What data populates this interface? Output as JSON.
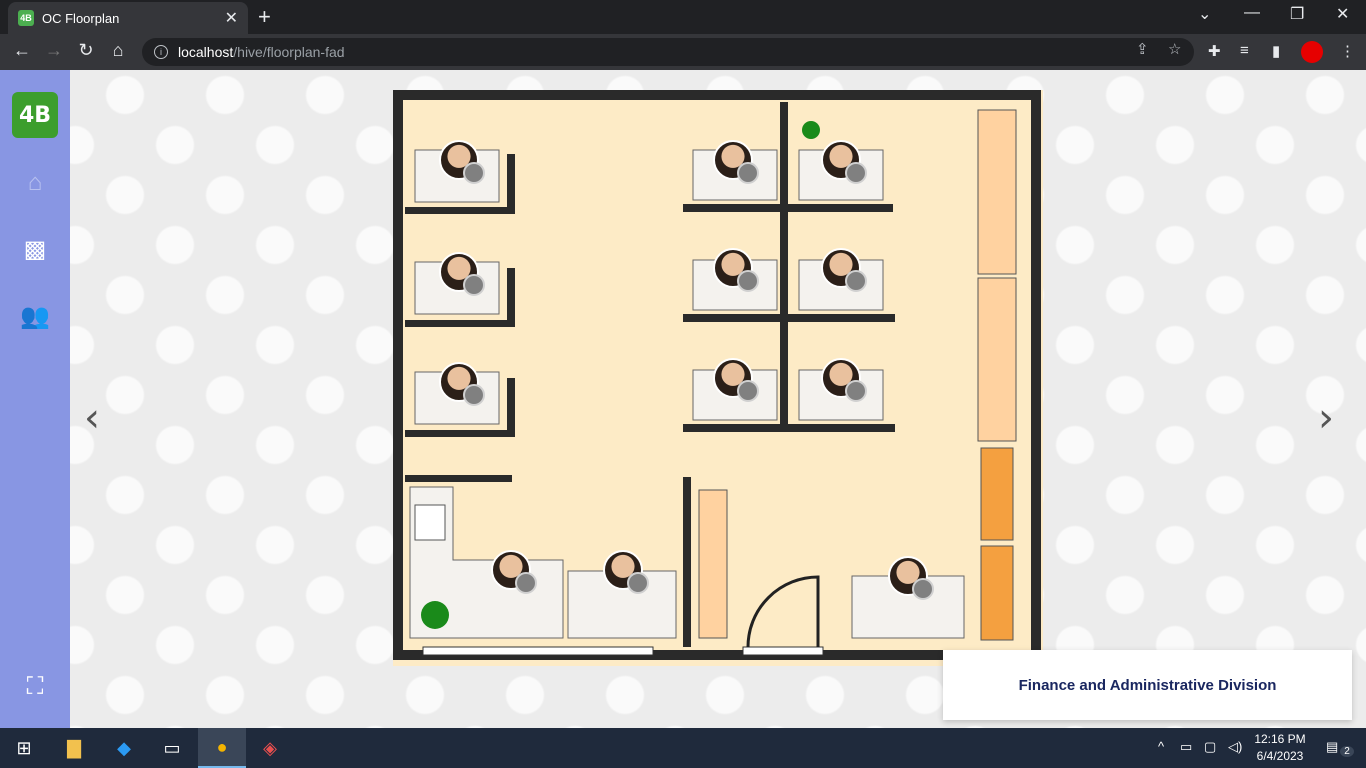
{
  "browser": {
    "tab_title": "OC Floorplan",
    "tab_icon": "4B",
    "url_host": "localhost",
    "url_path": "/hive/floorplan-fad"
  },
  "sidebar": {
    "logo_text": "4B",
    "items": [
      {
        "name": "home",
        "icon": "home-icon"
      },
      {
        "name": "map",
        "icon": "map-icon"
      },
      {
        "name": "people",
        "icon": "users-icon"
      },
      {
        "name": "directory",
        "icon": "group-frame-icon"
      }
    ]
  },
  "division_label": "Finance and Administrative Division",
  "taskbar": {
    "time": "12:16 PM",
    "date": "6/4/2023",
    "notifications": "2"
  }
}
